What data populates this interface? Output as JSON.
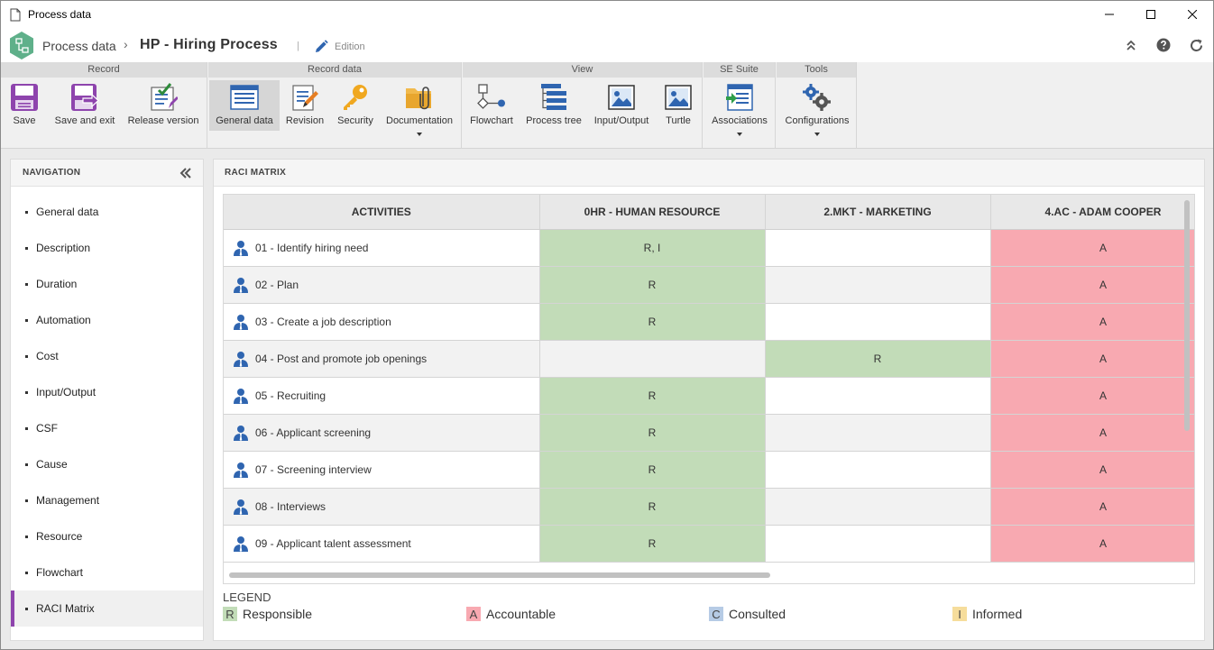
{
  "window": {
    "title": "Process data"
  },
  "header": {
    "breadcrumb_root": "Process data",
    "separator": "›",
    "title": "HP - Hiring Process",
    "pipe": "|",
    "mode": "Edition"
  },
  "toolbar": {
    "groups": [
      {
        "title": "Record",
        "buttons": [
          "Save",
          "Save and exit",
          "Release version"
        ]
      },
      {
        "title": "Record data",
        "buttons": [
          "General data",
          "Revision",
          "Security",
          "Documentation"
        ]
      },
      {
        "title": "View",
        "buttons": [
          "Flowchart",
          "Process tree",
          "Input/Output",
          "Turtle"
        ]
      },
      {
        "title": "SE Suite",
        "buttons": [
          "Associations"
        ]
      },
      {
        "title": "Tools",
        "buttons": [
          "Configurations"
        ]
      }
    ]
  },
  "navigation": {
    "title": "NAVIGATION",
    "items": [
      "General data",
      "Description",
      "Duration",
      "Automation",
      "Cost",
      "Input/Output",
      "CSF",
      "Cause",
      "Management",
      "Resource",
      "Flowchart",
      "RACI Matrix"
    ],
    "active": "RACI Matrix"
  },
  "raci": {
    "title": "RACI MATRIX",
    "columns": [
      "ACTIVITIES",
      "0HR - HUMAN RESOURCE",
      "2.MKT - MARKETING",
      "4.AC - ADAM COOPER"
    ],
    "rows": [
      {
        "activity": "01 - Identify hiring need",
        "cells": [
          "R, I",
          "",
          "A"
        ]
      },
      {
        "activity": "02 - Plan",
        "cells": [
          "R",
          "",
          "A"
        ]
      },
      {
        "activity": "03 - Create a job description",
        "cells": [
          "R",
          "",
          "A"
        ]
      },
      {
        "activity": "04 - Post and promote job openings",
        "cells": [
          "",
          "R",
          "A"
        ]
      },
      {
        "activity": "05 - Recruiting",
        "cells": [
          "R",
          "",
          "A"
        ]
      },
      {
        "activity": "06 - Applicant screening",
        "cells": [
          "R",
          "",
          "A"
        ]
      },
      {
        "activity": "07 - Screening interview",
        "cells": [
          "R",
          "",
          "A"
        ]
      },
      {
        "activity": "08 - Interviews",
        "cells": [
          "R",
          "",
          "A"
        ]
      },
      {
        "activity": "09 - Applicant talent assessment",
        "cells": [
          "R",
          "",
          "A"
        ]
      }
    ]
  },
  "legend": {
    "title": "LEGEND",
    "items": [
      {
        "code": "R",
        "label": "Responsible",
        "color": "#c2dcb8"
      },
      {
        "code": "A",
        "label": "Accountable",
        "color": "#f8a9b1"
      },
      {
        "code": "C",
        "label": "Consulted",
        "color": "#b6cbe5"
      },
      {
        "code": "I",
        "label": "Informed",
        "color": "#f6dd9c"
      }
    ]
  },
  "colors": {
    "accent": "#8e44ad",
    "logo": "#5fb08a",
    "responsible": "#c2dcb8",
    "accountable": "#f8a9b1",
    "icon_blue": "#2f65b0"
  }
}
